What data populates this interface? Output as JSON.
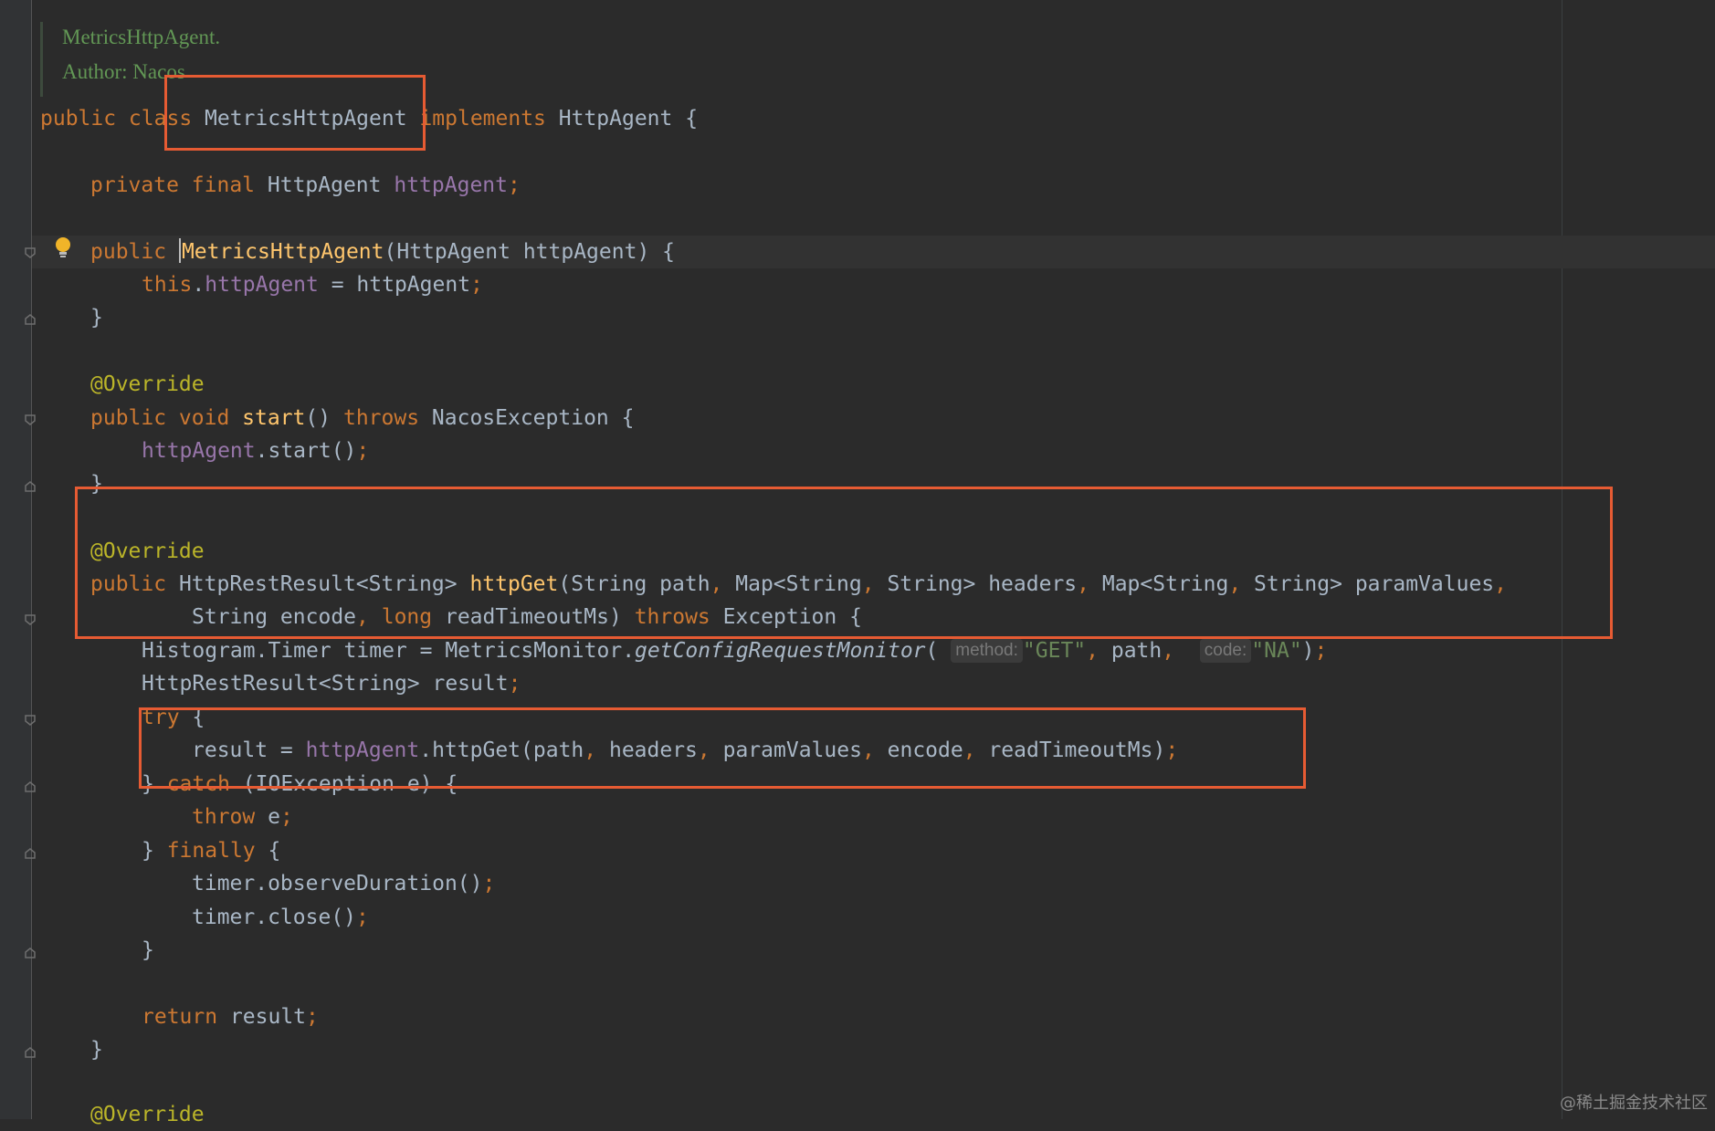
{
  "doc_comment": {
    "line1": "MetricsHttpAgent.",
    "line2": "Author: Nacos"
  },
  "code": {
    "l1": {
      "kw": "public class ",
      "name": "MetricsHttpAgent",
      "kw2": " implements ",
      "iface": "HttpAgent {"
    },
    "l2": {
      "kw": "private final ",
      "type": "HttpAgent ",
      "field": "httpAgent",
      "semi": ";"
    },
    "l3": {
      "kw": "public ",
      "name": "MetricsHttpAgent",
      "rest": "(HttpAgent httpAgent) {"
    },
    "l4": {
      "kw": "this",
      "dot": ".",
      "field": "httpAgent",
      "rest": " = httpAgent",
      "semi": ";"
    },
    "l5": {
      "text": "}"
    },
    "l6": {
      "ann": "@Override"
    },
    "l7": {
      "kw": "public void ",
      "fn": "start",
      "mid": "() ",
      "kw2": "throws ",
      "rest": "NacosException {"
    },
    "l8": {
      "field": "httpAgent",
      "rest": ".start()",
      "semi": ";"
    },
    "l9": {
      "text": "}"
    },
    "l10": {
      "ann": "@Override"
    },
    "l11": {
      "kw": "public ",
      "type": "HttpRestResult<String> ",
      "fn": "httpGet",
      "p1": "(String path",
      "c1": ", ",
      "p2": "Map<String",
      "c2": ", ",
      "p3": "String> headers",
      "c3": ", ",
      "p4": "Map<String",
      "c4": ", ",
      "p5": "String> paramValues",
      "c5": ","
    },
    "l12": {
      "p1": "String encode",
      "c1": ", ",
      "kw": "long ",
      "p2": "readTimeoutMs) ",
      "kw2": "throws ",
      "rest": "Exception {"
    },
    "l13": {
      "pre": "Histogram.Timer timer = MetricsMonitor.",
      "it": "getConfigRequestMonitor",
      "open": "( ",
      "hint1": "method:",
      "s1": "\"GET\"",
      "c1": ", ",
      "mid": "path",
      "c2": ",  ",
      "hint2": "code:",
      "s2": "\"NA\"",
      "close": ")",
      "semi": ";"
    },
    "l14": {
      "text": "HttpRestResult<String> result",
      "semi": ";"
    },
    "l15": {
      "kw": "try",
      "rest": " {"
    },
    "l16": {
      "pre": "result = ",
      "field": "httpAgent",
      "mid": ".httpGet(path",
      "c1": ", ",
      "a2": "headers",
      "c2": ", ",
      "a3": "paramValues",
      "c3": ", ",
      "a4": "encode",
      "c4": ", ",
      "a5": "readTimeoutMs)",
      "semi": ";"
    },
    "l17": {
      "pre": "} ",
      "kw": "catch",
      "rest": " (IOException e) {"
    },
    "l18": {
      "kw": "throw ",
      "rest": "e",
      "semi": ";"
    },
    "l19": {
      "pre": "} ",
      "kw": "finally",
      "rest": " {"
    },
    "l20": {
      "text": "timer.observeDuration()",
      "semi": ";"
    },
    "l21": {
      "text": "timer.close()",
      "semi": ";"
    },
    "l22": {
      "text": "}"
    },
    "l23": {
      "kw": "return ",
      "rest": "result",
      "semi": ";"
    },
    "l24": {
      "text": "}"
    },
    "l25": {
      "ann": "@Override"
    }
  },
  "watermark": "@稀土掘金技术社区",
  "colors": {
    "highlight_box": "#e65b33",
    "background": "#2b2b2b",
    "keyword": "#cc7832",
    "function": "#ffc66d",
    "field": "#9876aa",
    "annotation": "#bbb529",
    "string": "#6a8759"
  },
  "icons": [
    "lightbulb-icon",
    "fold-marker-icon"
  ]
}
